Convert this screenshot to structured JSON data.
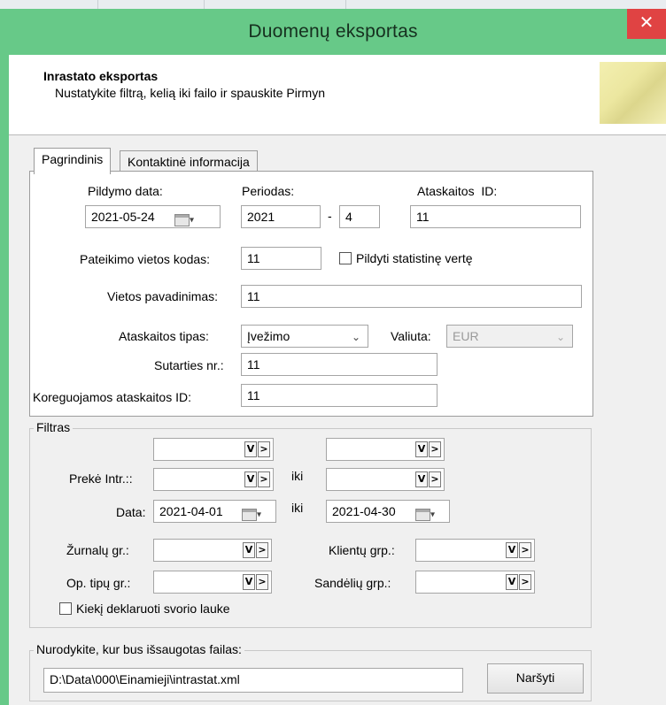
{
  "window": {
    "title": "Duomenų eksportas",
    "close_glyph": "✕"
  },
  "header": {
    "title": "Inrastato eksportas",
    "subtitle": "Nustatykite filtrą, kelią iki failo ir spauskite Pirmyn"
  },
  "tabs": [
    {
      "label": "Pagrindinis",
      "active": true
    },
    {
      "label": "Kontaktinė informacija",
      "active": false
    }
  ],
  "main": {
    "pildymo_data": {
      "label": "Pildymo data:",
      "value": "2021-05-24"
    },
    "periodas": {
      "label": "Periodas:",
      "year": "2021",
      "separator": "-",
      "month": "4"
    },
    "ataskaitos_id": {
      "label": "Ataskaitos  ID:",
      "value": "11"
    },
    "pateikimo_kodas": {
      "label": "Pateikimo vietos kodas:",
      "value": "11"
    },
    "pildyti_stat": {
      "label": "Pildyti statistinę vertę",
      "checked": false
    },
    "vietos_pavadinimas": {
      "label": "Vietos pavadinimas:",
      "value": "11"
    },
    "ataskaitos_tipas": {
      "label": "Ataskaitos tipas:",
      "value": "Įvežimo"
    },
    "valiuta": {
      "label": "Valiuta:",
      "value": "EUR"
    },
    "sutarties_nr": {
      "label": "Sutarties nr.:",
      "value": "11"
    },
    "koreguojamos_id": {
      "label": "Koreguojamos ataskaitos ID:",
      "value": "11"
    }
  },
  "filter": {
    "group_label": "Filtras",
    "preke_label": "Prekė Intr.::",
    "iki": "iki",
    "data_label": "Data:",
    "date_from": "2021-04-01",
    "date_to": "2021-04-30",
    "zurnalu_label": "Žurnalų gr.:",
    "klientu_label": "Klientų grp.:",
    "op_tipu_label": "Op. tipų gr.:",
    "sandeliu_label": "Sandėlių grp.:",
    "kiekis_label": "Kiekį deklaruoti svorio lauke",
    "kiekis_checked": false
  },
  "file": {
    "group_label": "Nurodykite, kur bus išsaugotas failas:",
    "path": "D:\\Data\\000\\Einamieji\\intrastat.xml",
    "browse_label": "Naršyti"
  },
  "glyphs": {
    "filter_btn": "V",
    "next_btn": ">",
    "dropdown_caret": "▾",
    "select_arrow": "⌄"
  },
  "icons": [
    "close-icon",
    "calendar-icon",
    "dropdown-caret-icon",
    "filter-icon",
    "arrow-right-icon",
    "checkbox-icon"
  ]
}
